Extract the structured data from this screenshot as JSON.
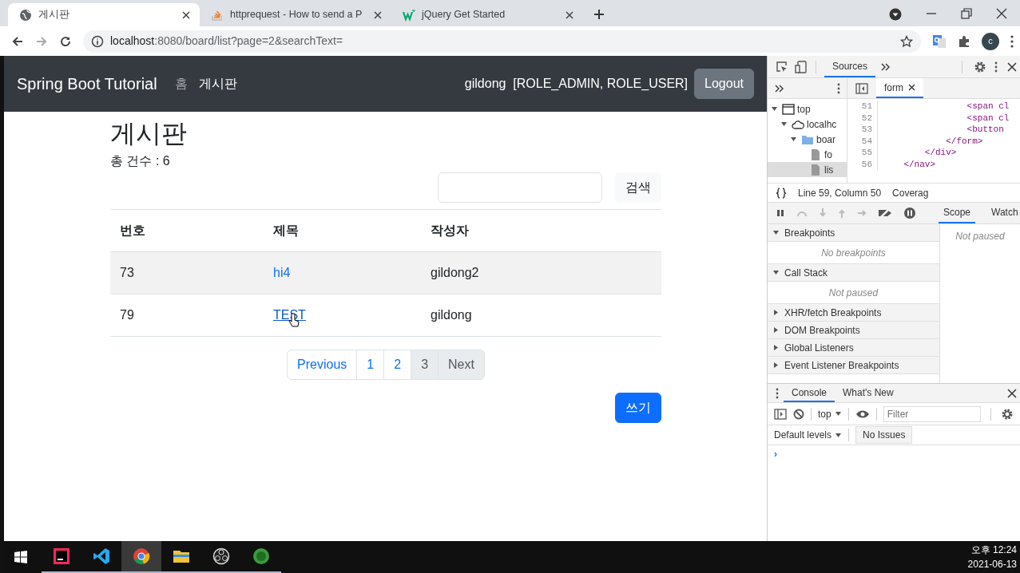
{
  "browser": {
    "tabs": [
      {
        "title": "게시판",
        "selected": true
      },
      {
        "title": "httprequest - How to send a P",
        "selected": false
      },
      {
        "title": "jQuery Get Started",
        "selected": false
      }
    ],
    "address": {
      "host": "localhost",
      "path": ":8080/board/list?page=2&searchText="
    },
    "profile_initial": "c"
  },
  "page": {
    "navbar": {
      "brand": "Spring Boot Tutorial",
      "links": [
        {
          "label": "홈",
          "selected": false
        },
        {
          "label": "게시판",
          "selected": true
        }
      ],
      "user": "gildong",
      "roles": "[ROLE_ADMIN, ROLE_USER]",
      "logout": "Logout"
    },
    "heading": "게시판",
    "count": "총 건수 : 6",
    "search_button": "검색",
    "table": {
      "columns": [
        "번호",
        "제목",
        "작성자"
      ],
      "rows": [
        {
          "number": "73",
          "title": "hi4",
          "author": "gildong2",
          "hovered": false
        },
        {
          "number": "79",
          "title": "TEST",
          "author": "gildong",
          "hovered": true
        }
      ]
    },
    "pagination": [
      {
        "label": "Previous",
        "disabled": false
      },
      {
        "label": "1",
        "disabled": false
      },
      {
        "label": "2",
        "disabled": false
      },
      {
        "label": "3",
        "disabled": true
      },
      {
        "label": "Next",
        "disabled": true
      }
    ],
    "write_button": "쓰기"
  },
  "devtools": {
    "panel_tabs": [
      {
        "label": "Sources",
        "selected": true
      }
    ],
    "navigator": [
      {
        "label": "top",
        "kind": "frame",
        "expanded": true,
        "selected": false,
        "children": [
          {
            "label": "localhc",
            "kind": "origin",
            "expanded": true,
            "selected": false,
            "children": [
              {
                "label": "boar",
                "kind": "folder",
                "expanded": true,
                "selected": false,
                "children": [
                  {
                    "label": "fo",
                    "kind": "file",
                    "selected": false
                  },
                  {
                    "label": "lis",
                    "kind": "file",
                    "selected": true
                  }
                ]
              }
            ]
          }
        ]
      }
    ],
    "editor_tab": "form",
    "code": [
      {
        "line": "51",
        "text": "                <span cl"
      },
      {
        "line": "52",
        "text": "                <span cl"
      },
      {
        "line": "53",
        "text": "                <button"
      },
      {
        "line": "54",
        "text": "            </form>"
      },
      {
        "line": "55",
        "text": "        </div>"
      },
      {
        "line": "56",
        "text": "    </nav>"
      }
    ],
    "position": "Line 59, Column 50",
    "coverage": "Coverag",
    "sidebar_tabs": [
      {
        "label": "Scope",
        "selected": true
      },
      {
        "label": "Watch",
        "selected": false
      }
    ],
    "scope_message": "Not paused",
    "sections": [
      {
        "title": "Breakpoints",
        "expanded": true,
        "message": "No breakpoints"
      },
      {
        "title": "Call Stack",
        "expanded": true,
        "message": "Not paused"
      },
      {
        "title": "XHR/fetch Breakpoints",
        "expanded": false
      },
      {
        "title": "DOM Breakpoints",
        "expanded": false
      },
      {
        "title": "Global Listeners",
        "expanded": false
      },
      {
        "title": "Event Listener Breakpoints",
        "expanded": false
      }
    ],
    "drawer_tabs": [
      {
        "label": "Console",
        "selected": true
      },
      {
        "label": "What's New",
        "selected": false
      }
    ],
    "context": "top",
    "filter_placeholder": "Filter",
    "levels": "Default levels",
    "issues": "No Issues",
    "prompt": "›"
  },
  "taskbar": {
    "apps": [
      {
        "selected": false,
        "running": true
      },
      {
        "selected": false,
        "running": true
      },
      {
        "selected": true,
        "running": true
      },
      {
        "selected": false,
        "running": true
      },
      {
        "selected": false,
        "running": true
      },
      {
        "selected": false,
        "running": true
      }
    ],
    "time": "오후 12:24",
    "date": "2021-06-13"
  }
}
